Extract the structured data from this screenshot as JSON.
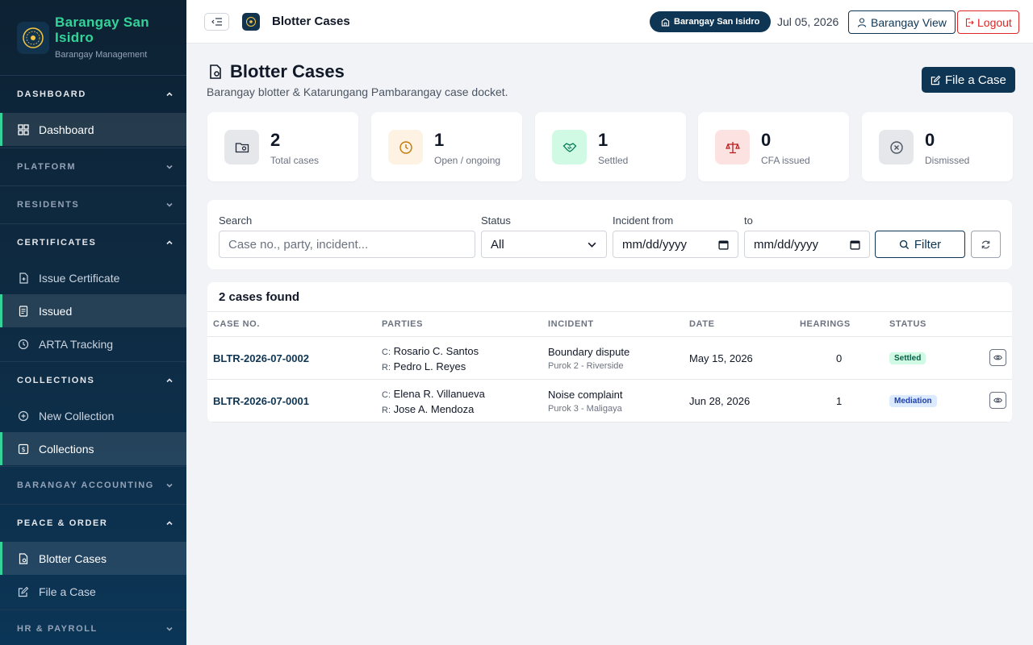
{
  "brand": {
    "name": "Barangay San Isidro",
    "subtitle": "Barangay Management"
  },
  "sidebar": {
    "dashboard": {
      "label": "DASHBOARD",
      "items": [
        {
          "label": "Dashboard"
        }
      ]
    },
    "platform": {
      "label": "PLATFORM"
    },
    "residents": {
      "label": "RESIDENTS"
    },
    "certificates": {
      "label": "CERTIFICATES",
      "items": [
        {
          "label": "Issue Certificate"
        },
        {
          "label": "Issued"
        },
        {
          "label": "ARTA Tracking"
        }
      ]
    },
    "collections": {
      "label": "COLLECTIONS",
      "items": [
        {
          "label": "New Collection"
        },
        {
          "label": "Collections"
        }
      ]
    },
    "accounting": {
      "label": "BARANGAY ACCOUNTING"
    },
    "peace": {
      "label": "PEACE & ORDER",
      "items": [
        {
          "label": "Blotter Cases"
        },
        {
          "label": "File a Case"
        }
      ]
    },
    "hr": {
      "label": "HR & PAYROLL"
    }
  },
  "topbar": {
    "title": "Blotter Cases",
    "barangay": "Barangay San Isidro",
    "date": "Jul 05, 2026",
    "view_label": "Barangay View",
    "logout_label": "Logout"
  },
  "page": {
    "title": "Blotter Cases",
    "subtitle": "Barangay blotter & Katarungang Pambarangay case docket.",
    "file_case_label": "File a Case"
  },
  "stats": [
    {
      "value": "2",
      "label": "Total cases"
    },
    {
      "value": "1",
      "label": "Open / ongoing"
    },
    {
      "value": "1",
      "label": "Settled"
    },
    {
      "value": "0",
      "label": "CFA issued"
    },
    {
      "value": "0",
      "label": "Dismissed"
    }
  ],
  "filters": {
    "search_label": "Search",
    "search_placeholder": "Case no., party, incident...",
    "status_label": "Status",
    "status_value": "All",
    "from_label": "Incident from",
    "from_placeholder": "mm/dd/yyyy",
    "to_label": "to",
    "to_placeholder": "mm/dd/yyyy",
    "filter_label": "Filter"
  },
  "table": {
    "count_label": "2 cases found",
    "headers": [
      "CASE NO.",
      "PARTIES",
      "INCIDENT",
      "DATE",
      "HEARINGS",
      "STATUS"
    ],
    "complainant_prefix": "C:",
    "respondent_prefix": "R:",
    "rows": [
      {
        "case_no": "BLTR-2026-07-0002",
        "complainant": "Rosario C. Santos",
        "respondent": "Pedro L. Reyes",
        "incident": "Boundary dispute",
        "location": "Purok 2 - Riverside",
        "date": "May 15, 2026",
        "hearings": "0",
        "status": "Settled"
      },
      {
        "case_no": "BLTR-2026-07-0001",
        "complainant": "Elena R. Villanueva",
        "respondent": "Jose A. Mendoza",
        "incident": "Noise complaint",
        "location": "Purok 3 - Maligaya",
        "date": "Jun 28, 2026",
        "hearings": "1",
        "status": "Mediation"
      }
    ]
  },
  "colors": {
    "primary": "#0e3553",
    "accent_green": "#34d399",
    "danger": "#dc2626"
  }
}
